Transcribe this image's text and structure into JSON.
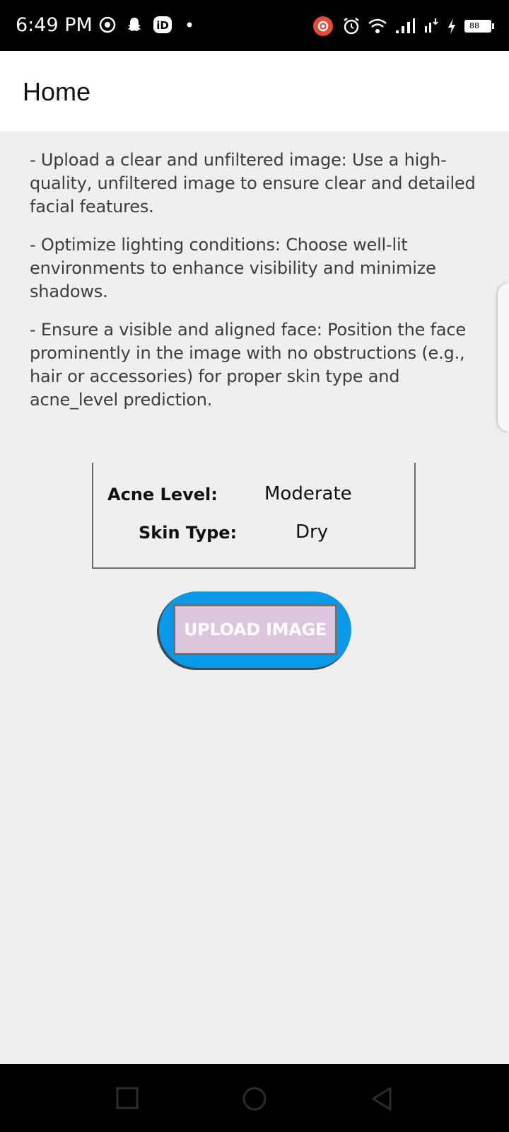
{
  "status_bar": {
    "time": "6:49 PM",
    "battery": "88",
    "left_icons": [
      "soccer-ball-icon",
      "snapchat-icon",
      "notification-app-icon",
      "dot-icon"
    ],
    "right_icons": [
      "recording-icon",
      "alarm-icon",
      "wifi-icon",
      "signal-icon",
      "data-speed-icon",
      "charging-icon",
      "battery-icon"
    ],
    "colors": {
      "background": "#000000",
      "recording": "#e5493a"
    }
  },
  "app_bar": {
    "title": "Home"
  },
  "instructions": [
    "- Upload a clear and unfiltered image: Use a high-quality, unfiltered image to ensure clear and detailed facial features.",
    "- Optimize lighting conditions: Choose well-lit environments to enhance visibility and minimize shadows.",
    "- Ensure a visible and aligned face: Position the face prominently in the image with no obstructions (e.g., hair or accessories) for proper skin type and acne_level prediction."
  ],
  "results": {
    "acne_label": "Acne Level:",
    "acne_value": "Moderate",
    "skin_label": "Skin Type:",
    "skin_value": "Dry"
  },
  "upload_button": {
    "label": "UPLOAD IMAGE",
    "colors": {
      "outer": "#0a98e8",
      "inner": "#dcc5dd"
    }
  },
  "nav_bar": {
    "buttons": [
      "recent-apps-icon",
      "home-icon",
      "back-icon"
    ]
  }
}
